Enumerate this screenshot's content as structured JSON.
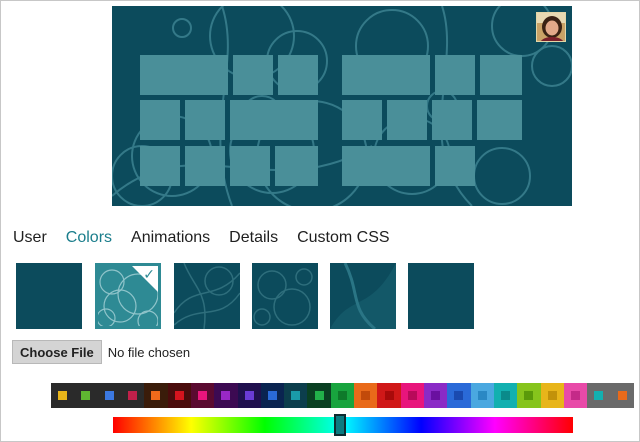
{
  "preview": {
    "background_color": "#0c4b5c",
    "tile_color": "#4a8f99",
    "avatar_icon": "user-avatar-photo"
  },
  "tabs": [
    {
      "label": "User",
      "active": false
    },
    {
      "label": "Colors",
      "active": true
    },
    {
      "label": "Animations",
      "active": false
    },
    {
      "label": "Details",
      "active": false
    },
    {
      "label": "Custom CSS",
      "active": false
    }
  ],
  "backgrounds": {
    "selected_index": 1,
    "selected_icon": "checkmark-icon",
    "count": 6
  },
  "file_input": {
    "button_label": "Choose File",
    "status_text": "No file chosen"
  },
  "swatches": [
    {
      "bg": "#2a2a2a",
      "chip": "#e8b51a"
    },
    {
      "bg": "#2a2a2a",
      "chip": "#5fb631"
    },
    {
      "bg": "#2a2a2a",
      "chip": "#3b78e0"
    },
    {
      "bg": "#2a2a2a",
      "chip": "#c0204a"
    },
    {
      "bg": "#3a1c0a",
      "chip": "#f06a1b"
    },
    {
      "bg": "#4a0c0c",
      "chip": "#d4141e"
    },
    {
      "bg": "#5a0a30",
      "chip": "#e8157c"
    },
    {
      "bg": "#3c0a52",
      "chip": "#9a28c6"
    },
    {
      "bg": "#20104e",
      "chip": "#6a3bd4"
    },
    {
      "bg": "#0a2450",
      "chip": "#2a6ad8"
    },
    {
      "bg": "#0c3e4c",
      "chip": "#1a9aa8"
    },
    {
      "bg": "#0a4022",
      "chip": "#22b04a"
    },
    {
      "bg": "#18a43e",
      "chip": "#0e7a2a"
    },
    {
      "bg": "#e96a1a",
      "chip": "#c24a0a"
    },
    {
      "bg": "#d01818",
      "chip": "#a80a0a"
    },
    {
      "bg": "#e8157c",
      "chip": "#b80a5a"
    },
    {
      "bg": "#8a2ac6",
      "chip": "#6a10a0"
    },
    {
      "bg": "#2a6ad8",
      "chip": "#1a4ab0"
    },
    {
      "bg": "#4aa8e0",
      "chip": "#2a88c4"
    },
    {
      "bg": "#12b0b0",
      "chip": "#0a8a8a"
    },
    {
      "bg": "#86c41c",
      "chip": "#5a9a0a"
    },
    {
      "bg": "#e8b51a",
      "chip": "#c2920a"
    },
    {
      "bg": "#e84aa8",
      "chip": "#c42a88"
    },
    {
      "bg": "#6a6a6a",
      "chip": "#12b0b0"
    },
    {
      "bg": "#6a6a6a",
      "chip": "#e86a1a"
    }
  ],
  "hue": {
    "value_percent": 50,
    "handle_color": "#0c7a80"
  }
}
